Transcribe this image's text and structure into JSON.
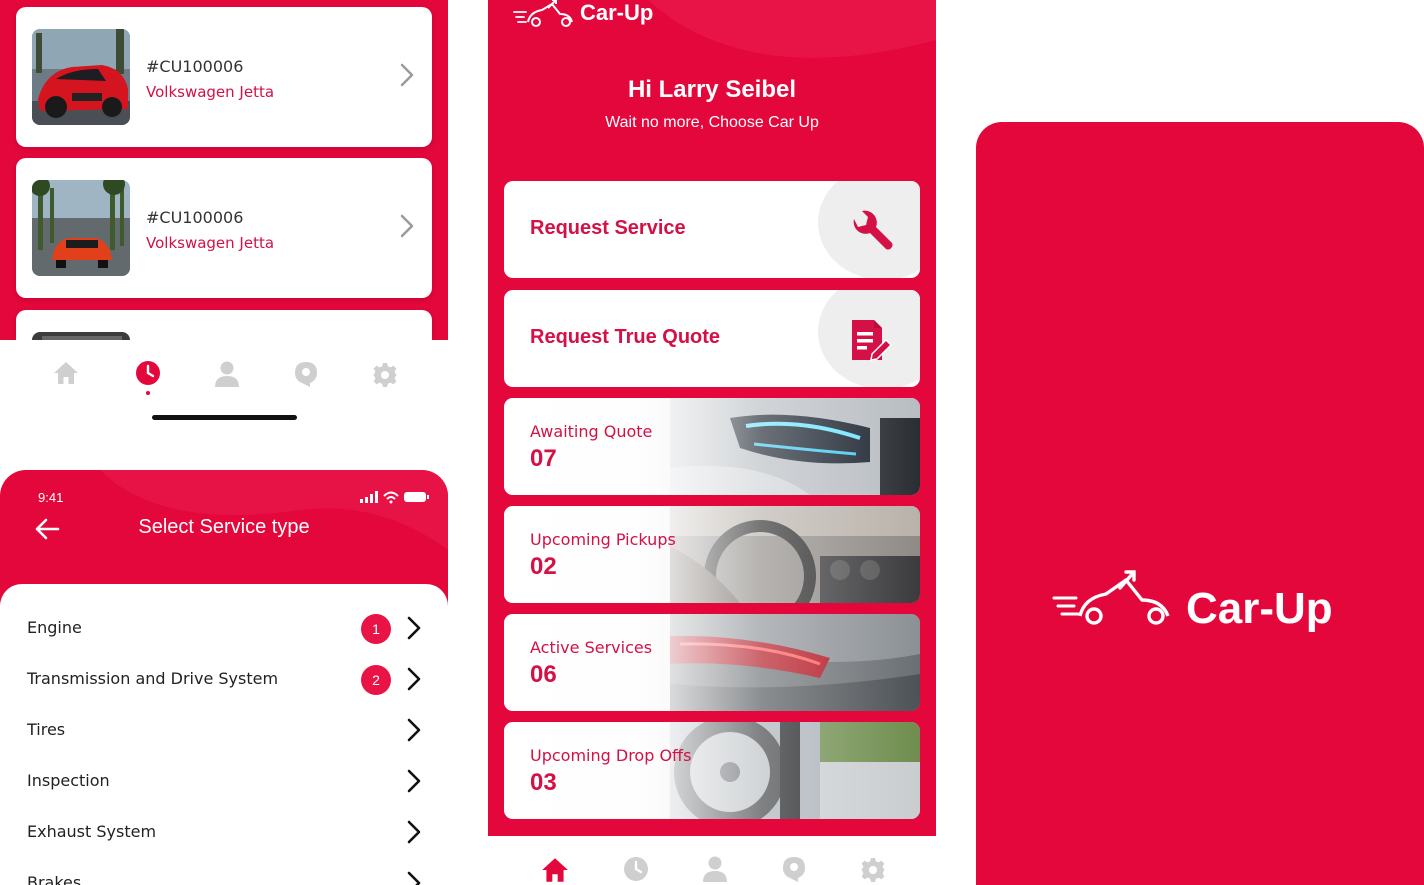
{
  "history": {
    "vehicles": [
      {
        "id": "#CU100006",
        "name": "Volkswagen Jetta"
      },
      {
        "id": "#CU100006",
        "name": "Volkswagen Jetta"
      }
    ]
  },
  "service_type": {
    "status_time": "9:41",
    "title": "Select Service type",
    "items": [
      {
        "label": "Engine",
        "badge": "1"
      },
      {
        "label": "Transmission and Drive System",
        "badge": "2"
      },
      {
        "label": "Tires",
        "badge": ""
      },
      {
        "label": "Inspection",
        "badge": ""
      },
      {
        "label": "Exhaust System",
        "badge": ""
      },
      {
        "label": "Brakes",
        "badge": ""
      }
    ]
  },
  "home": {
    "logo_text": "Car-Up",
    "greeting": "Hi Larry Seibel",
    "subtitle": "Wait no more, Choose Car Up",
    "actions": [
      {
        "label": "Request Service",
        "icon": "wrench-icon"
      },
      {
        "label": "Request True Quote",
        "icon": "quote-document-icon"
      }
    ],
    "stats": [
      {
        "label": "Awaiting Quote",
        "value": "07"
      },
      {
        "label": "Upcoming Pickups",
        "value": "02"
      },
      {
        "label": "Active Services",
        "value": "06"
      },
      {
        "label": "Upcoming Drop Offs",
        "value": "03"
      }
    ]
  },
  "splash": {
    "logo_text": "Car-Up"
  },
  "nav": {
    "items": [
      "home-icon",
      "clock-icon",
      "profile-icon",
      "support-icon",
      "settings-icon"
    ]
  },
  "colors": {
    "brand": "#e3073c",
    "accent_text": "#d31146",
    "inactive_icon": "#cfcfcf"
  }
}
